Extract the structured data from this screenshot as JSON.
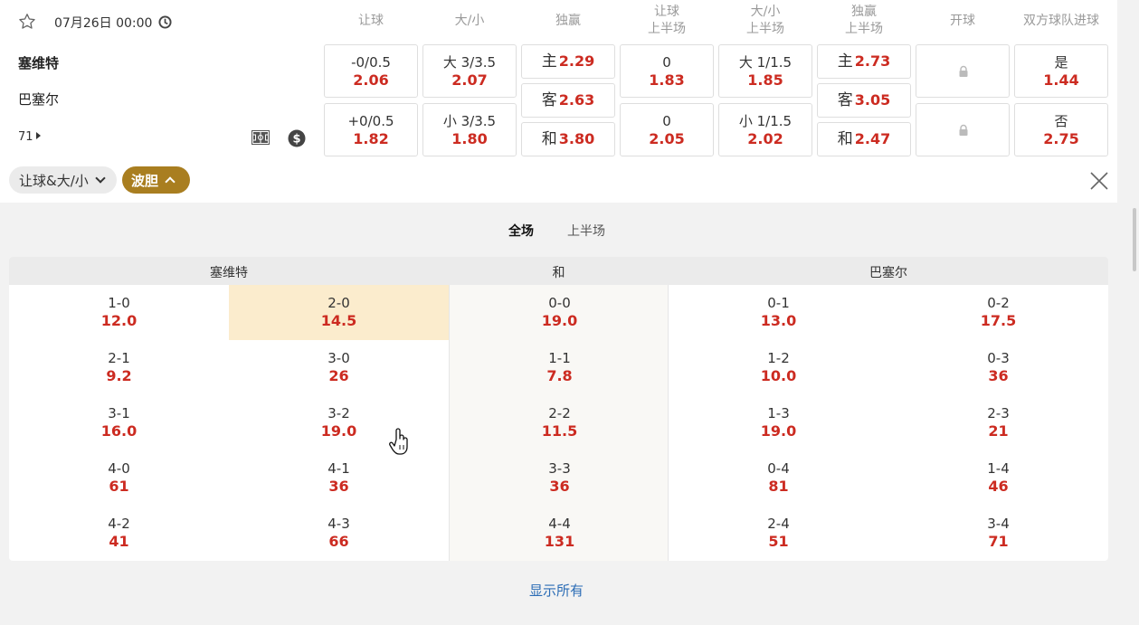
{
  "match": {
    "date": "07月26日 00:00",
    "home": "塞维特",
    "away": "巴塞尔",
    "minute": "71"
  },
  "headers": {
    "handicap": [
      "让球"
    ],
    "total": [
      "大/小"
    ],
    "win": [
      "独赢"
    ],
    "handicap_half": [
      "让球",
      "上半场"
    ],
    "total_half": [
      "大/小",
      "上半场"
    ],
    "win_half": [
      "独赢",
      "上半场"
    ],
    "kickoff": [
      "开球"
    ],
    "btts": [
      "双方球队进球"
    ]
  },
  "odds": {
    "handicap": [
      {
        "line": "-0/0.5",
        "odd": "2.06"
      },
      {
        "line": "+0/0.5",
        "odd": "1.82"
      }
    ],
    "total": [
      {
        "line": "大 3/3.5",
        "odd": "2.07"
      },
      {
        "line": "小 3/3.5",
        "odd": "1.80"
      }
    ],
    "win": [
      {
        "label": "主",
        "odd": "2.29"
      },
      {
        "label": "客",
        "odd": "2.63"
      },
      {
        "label": "和",
        "odd": "3.80"
      }
    ],
    "handicap_half": [
      {
        "line": "0",
        "odd": "1.83"
      },
      {
        "line": "0",
        "odd": "2.05"
      }
    ],
    "total_half": [
      {
        "line": "大 1/1.5",
        "odd": "1.85"
      },
      {
        "line": "小 1/1.5",
        "odd": "2.02"
      }
    ],
    "win_half": [
      {
        "label": "主",
        "odd": "2.73"
      },
      {
        "label": "客",
        "odd": "3.05"
      },
      {
        "label": "和",
        "odd": "2.47"
      }
    ],
    "btts": [
      {
        "line": "是",
        "odd": "1.44"
      },
      {
        "line": "否",
        "odd": "2.75"
      }
    ]
  },
  "filters": {
    "market_pill": "让球&大/小",
    "correct_score_pill": "波胆"
  },
  "tabs": {
    "full": "全场",
    "half": "上半场"
  },
  "grid": {
    "home_label": "塞维特",
    "draw_label": "和",
    "away_label": "巴塞尔",
    "columns": [
      [
        {
          "s": "1-0",
          "o": "12.0"
        },
        {
          "s": "2-1",
          "o": "9.2"
        },
        {
          "s": "3-1",
          "o": "16.0"
        },
        {
          "s": "4-0",
          "o": "61"
        },
        {
          "s": "4-2",
          "o": "41"
        }
      ],
      [
        {
          "s": "2-0",
          "o": "14.5"
        },
        {
          "s": "3-0",
          "o": "26"
        },
        {
          "s": "3-2",
          "o": "19.0"
        },
        {
          "s": "4-1",
          "o": "36"
        },
        {
          "s": "4-3",
          "o": "66"
        }
      ],
      [
        {
          "s": "0-0",
          "o": "19.0"
        },
        {
          "s": "1-1",
          "o": "7.8"
        },
        {
          "s": "2-2",
          "o": "11.5"
        },
        {
          "s": "3-3",
          "o": "36"
        },
        {
          "s": "4-4",
          "o": "131"
        }
      ],
      [
        {
          "s": "0-1",
          "o": "13.0"
        },
        {
          "s": "1-2",
          "o": "10.0"
        },
        {
          "s": "1-3",
          "o": "19.0"
        },
        {
          "s": "0-4",
          "o": "81"
        },
        {
          "s": "2-4",
          "o": "51"
        }
      ],
      [
        {
          "s": "0-2",
          "o": "17.5"
        },
        {
          "s": "0-3",
          "o": "36"
        },
        {
          "s": "2-3",
          "o": "21"
        },
        {
          "s": "1-4",
          "o": "46"
        },
        {
          "s": "3-4",
          "o": "71"
        }
      ]
    ]
  },
  "show_all": "显示所有",
  "colors": {
    "odd": "#cc2b21",
    "accent": "#a97e20",
    "highlight": "#fbeccd",
    "link": "#2b6cb5"
  }
}
